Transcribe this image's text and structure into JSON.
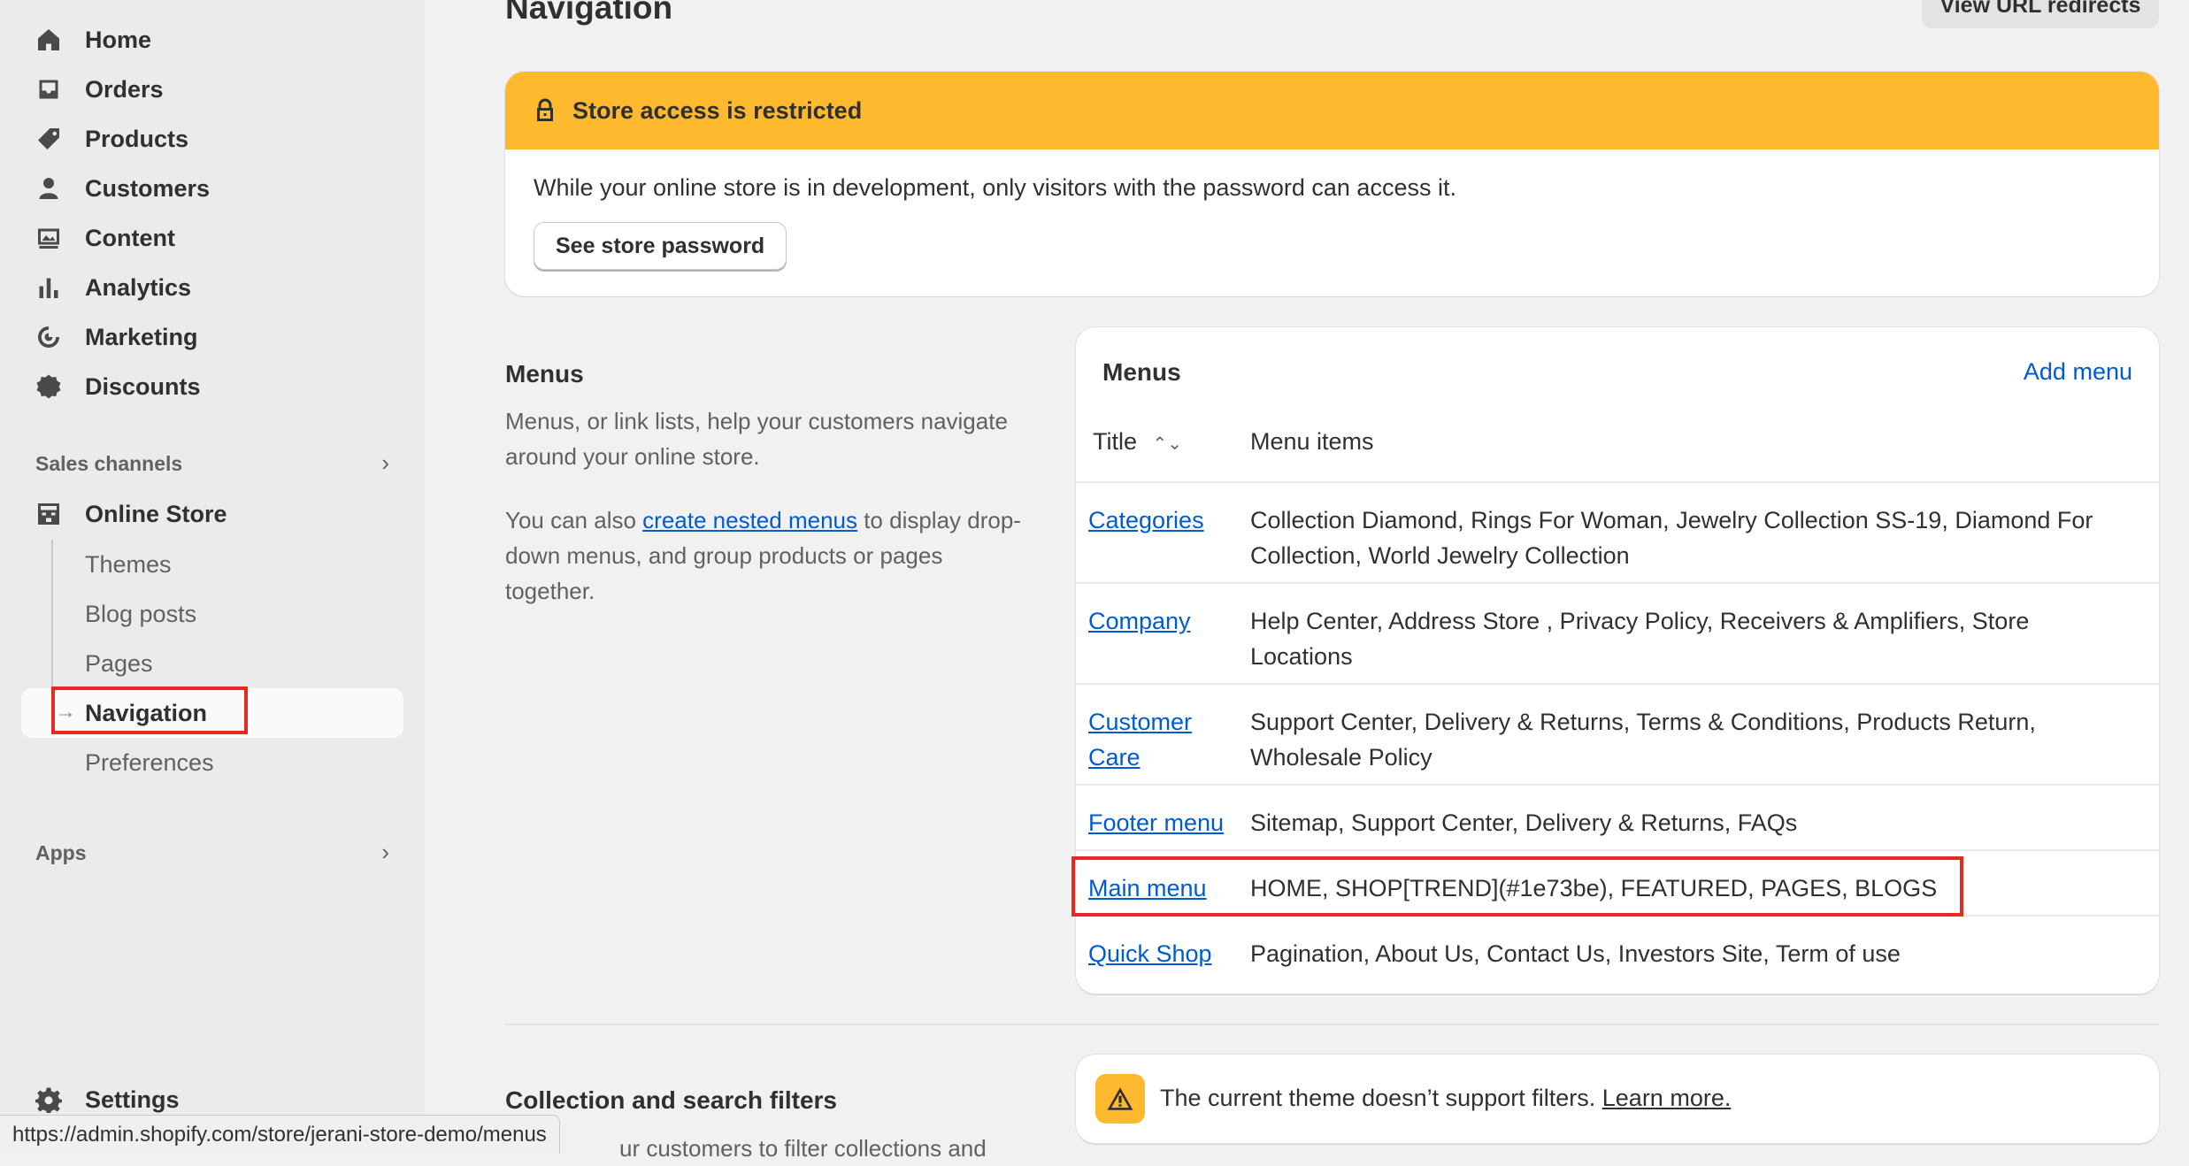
{
  "sidebar": {
    "items": [
      {
        "label": "Home",
        "icon": "home-icon"
      },
      {
        "label": "Orders",
        "icon": "inbox-icon"
      },
      {
        "label": "Products",
        "icon": "tag-icon"
      },
      {
        "label": "Customers",
        "icon": "person-icon"
      },
      {
        "label": "Content",
        "icon": "image-icon"
      },
      {
        "label": "Analytics",
        "icon": "bar-chart-icon"
      },
      {
        "label": "Marketing",
        "icon": "target-icon"
      },
      {
        "label": "Discounts",
        "icon": "discount-icon"
      }
    ],
    "sales_channels_label": "Sales channels",
    "online_store_label": "Online Store",
    "sub_items": [
      "Themes",
      "Blog posts",
      "Pages",
      "Navigation",
      "Preferences"
    ],
    "apps_label": "Apps",
    "settings_label": "Settings"
  },
  "header": {
    "title": "Navigation",
    "redirects_button": "View URL redirects"
  },
  "banner": {
    "title": "Store access is restricted",
    "text": "While your online store is in development, only visitors with the password can access it.",
    "button": "See store password"
  },
  "menus_section": {
    "title": "Menus",
    "desc": "Menus, or link lists, help your customers navigate around your online store.",
    "also_prefix": "You can also ",
    "also_link": "create nested menus",
    "also_suffix": " to display drop-down menus, and group products or pages together."
  },
  "menus_card": {
    "title": "Menus",
    "add_menu": "Add menu",
    "col_title": "Title",
    "col_items": "Menu items",
    "rows": [
      {
        "title": "Categories",
        "items": "Collection Diamond, Rings For Woman, Jewelry Collection SS-19, Diamond For Collection, World Jewelry Collection"
      },
      {
        "title": "Company",
        "items": "Help Center, Address Store , Privacy Policy, Receivers & Amplifiers, Store Locations"
      },
      {
        "title": "Customer Care",
        "items": "Support Center, Delivery & Returns, Terms & Conditions, Products Return, Wholesale Policy"
      },
      {
        "title": "Footer menu",
        "items": "Sitemap, Support Center, Delivery & Returns, FAQs"
      },
      {
        "title": "Main menu",
        "items": "HOME, SHOP[TREND](#1e73be), FEATURED, PAGES, BLOGS"
      },
      {
        "title": "Quick Shop",
        "items": "Pagination, About Us, Contact Us, Investors Site, Term of use"
      }
    ]
  },
  "filters_section": {
    "title": "Collection and search filters",
    "desc_partial": "ur customers to filter collections and",
    "notice": "The current theme doesn’t support filters.",
    "learn_more": "Learn more."
  },
  "status_bar": {
    "url": "https://admin.shopify.com/store/jerani-store-demo/menus"
  },
  "colors": {
    "accent_link": "#005bd3",
    "banner_warning": "#ffb92e",
    "highlight": "#e32b22"
  }
}
